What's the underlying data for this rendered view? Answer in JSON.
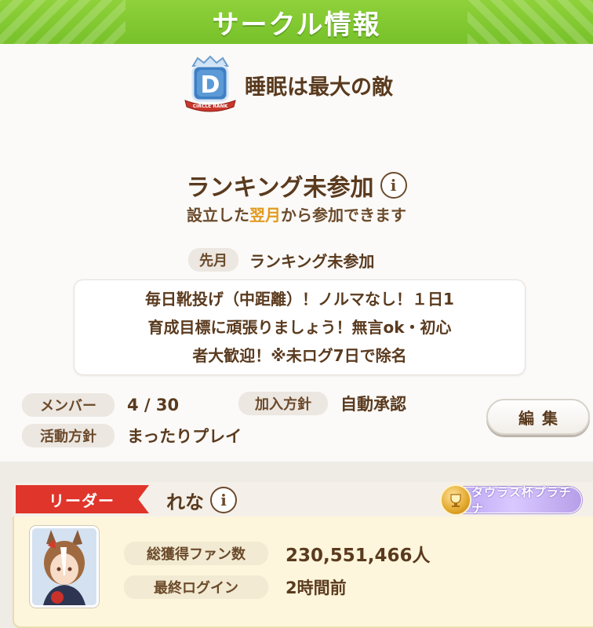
{
  "header": {
    "title": "サークル情報"
  },
  "circle": {
    "rank_letter": "D",
    "rank_caption": "CIRCLE RANK",
    "name": "睡眠は最大の敵"
  },
  "ranking": {
    "title": "ランキング未参加",
    "notice_before": "設立した",
    "notice_accent": "翌月",
    "notice_after": "から参加できます",
    "last_month_label": "先月",
    "last_month_value": "ランキング未参加"
  },
  "description": "毎日靴投げ（中距離）！ノルマなし！１日1\n育成目標に頑張りましょう！無言ok・初心\n者大歓迎！※未ログ7日で除名",
  "stats": {
    "members_label": "メンバー",
    "members_value": "4 / 30",
    "join_policy_label": "加入方針",
    "join_policy_value": "自動承認",
    "activity_label": "活動方針",
    "activity_value": "まったりプレイ"
  },
  "edit_button": "編集",
  "leader": {
    "ribbon": "リーダー",
    "name": "れな",
    "trophy": "タウラス杯プラチナ",
    "fans_label": "総獲得ファン数",
    "fans_value": "230,551,466人",
    "last_login_label": "最終ログイン",
    "last_login_value": "2時間前"
  },
  "colors": {
    "header_green": "#7fc62f",
    "text_brown": "#5a3a1e",
    "accent_orange": "#e29a1f",
    "ribbon_red": "#e0352b",
    "trophy_purple": "#b59ef0"
  }
}
